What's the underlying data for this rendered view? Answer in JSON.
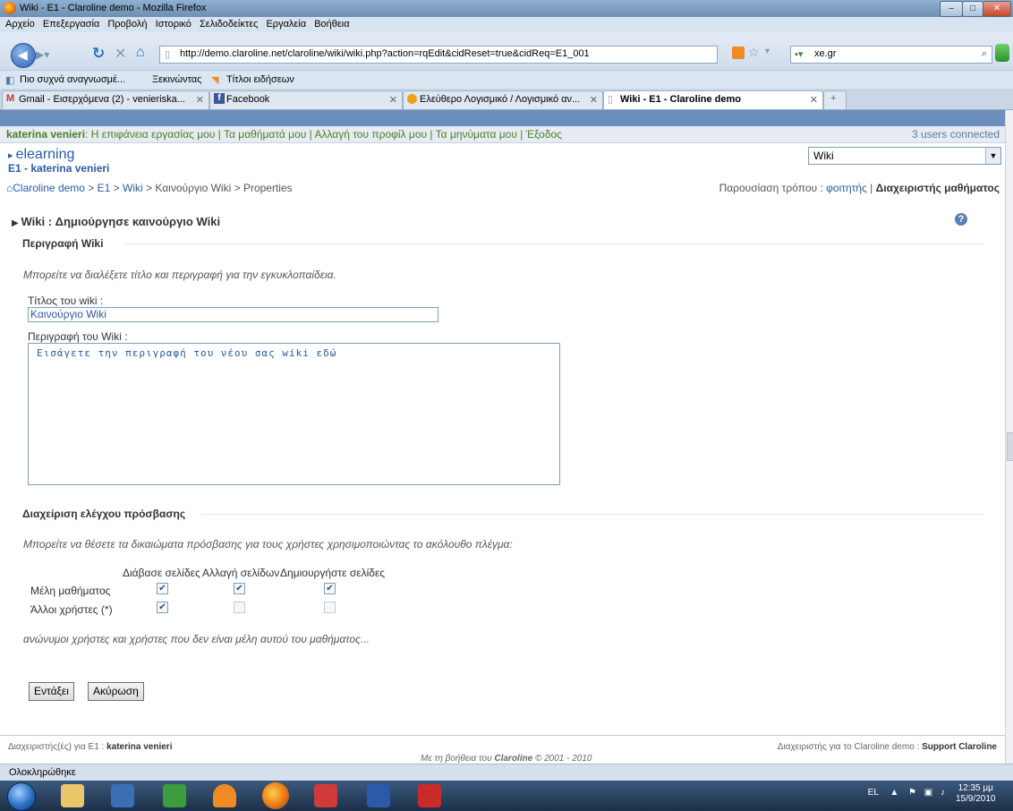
{
  "browser": {
    "window_title": "Wiki - E1 - Claroline demo - Mozilla Firefox",
    "menus": [
      "Αρχείο",
      "Επεξεργασία",
      "Προβολή",
      "Ιστορικό",
      "Σελιδοδείκτες",
      "Εργαλεία",
      "Βοήθεια"
    ],
    "url": "http://demo.claroline.net/claroline/wiki/wiki.php?action=rqEdit&cidReset=true&cidReq=E1_001",
    "search_value": "xe.gr",
    "bookmarks": [
      "Πιο συχνά αναγνωσμέ...",
      "Ξεκινώντας",
      "Τίτλοι ειδήσεων"
    ],
    "tabs": [
      {
        "label": "Gmail - Εισερχόμενα (2) - venieriska..."
      },
      {
        "label": "Facebook"
      },
      {
        "label": "Ελεύθερο Λογισμικό / Λογισμικό αν..."
      },
      {
        "label": "Wiki - E1 - Claroline demo"
      }
    ],
    "status": "Ολοκληρώθηκε"
  },
  "userbar": {
    "user": "katerina venieri",
    "links": ": Η επιφάνεια εργασίας μου | Τα μαθήματά μου | Αλλαγή του προφίλ μου | Τα μηνύματα μου | Έξοδος",
    "connected": "3 users connected"
  },
  "header": {
    "site": "elearning",
    "course": "E1 - katerina venieri",
    "tool_select": "Wiki"
  },
  "breadcrumb": {
    "home": "Claroline demo",
    "course": "E1",
    "wiki": "Wiki",
    "new_wiki": "Καινούργιο Wiki",
    "current": "Properties"
  },
  "viewmode": {
    "prefix": "Παρουσίαση τρόπου :",
    "student": "φοιτητής",
    "manager": "Διαχειριστής μαθήματος"
  },
  "page": {
    "title": "Wiki : Δημιούργησε καινούργιο Wiki",
    "section1": "Περιγραφή Wiki",
    "section1_help": "Μπορείτε να διαλέξετε τίτλο και περιγραφή για την εγκυκλοπαίδεια.",
    "title_label": "Τίτλος του wiki :",
    "title_value": "Καινούργιο Wiki",
    "desc_label": "Περιγραφή του Wiki :",
    "desc_value": "Εισάγετε την περιγραφή του νέου σας wiki εδώ",
    "section2": "Διαχείριση ελέγχου πρόσβασης",
    "section2_help": "Μπορείτε να θέσετε τα δικαιώματα πρόσβασης για τους χρήστες χρησιμοποιώντας το ακόλουθο πλέγμα:",
    "acl_headers": [
      "Διάβασε σελίδες",
      "Αλλαγή σελίδων",
      "Δημιουργήστε σελίδες"
    ],
    "acl_rows": [
      {
        "label": "Μέλη μαθήματος",
        "values": [
          true,
          true,
          true
        ]
      },
      {
        "label": "Άλλοι χρήστες (*)",
        "values": [
          true,
          false,
          false
        ]
      }
    ],
    "acl_note": "ανώνυμοι χρήστες και χρήστες που δεν είναι μέλη αυτού του μαθήματος...",
    "ok_label": "Εντάξει",
    "cancel_label": "Ακύρωση"
  },
  "footer": {
    "left_prefix": "Διαχειριστής(ές) για E1 :",
    "left_name": "katerina venieri",
    "right_prefix": "Διαχειριστής για το Claroline demo :",
    "right_name": "Support Claroline",
    "center_prefix": "Με τη βοήθεια του",
    "center_brand": "Claroline",
    "center_suffix": "© 2001 - 2010"
  },
  "taskbar": {
    "lang": "EL",
    "time": "12:35 μμ",
    "date": "15/9/2010"
  },
  "colors": {
    "accent_blue": "#2a5aa3",
    "user_green": "#4a7e22",
    "top_bar": "#6b8ebd"
  }
}
